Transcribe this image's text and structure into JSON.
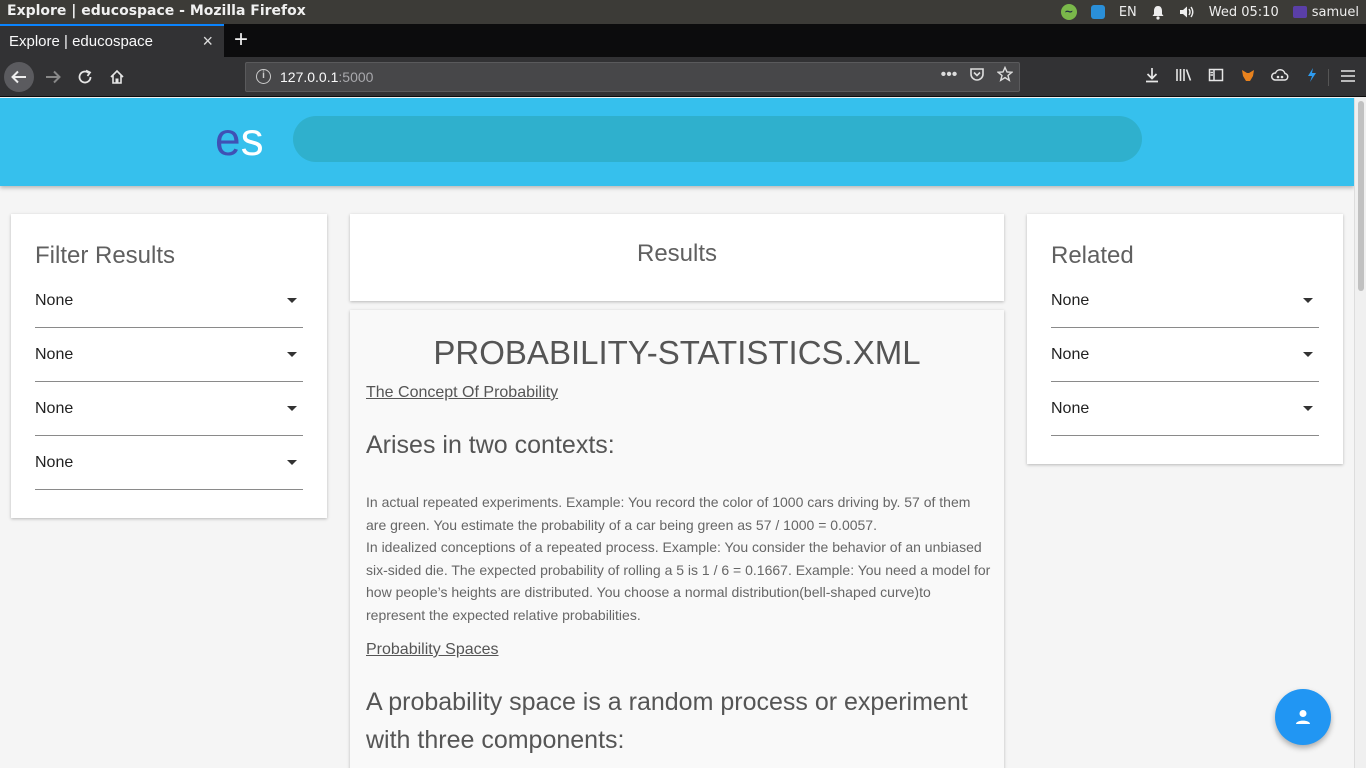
{
  "os": {
    "window_title": "Explore | educospace - Mozilla Firefox",
    "indicators": [
      "EN"
    ],
    "clock": "Wed 05:10",
    "user": "samuel"
  },
  "browser": {
    "tab_title": "Explore | educospace",
    "tab_close": "×",
    "new_tab": "+",
    "url_host": "127.0.0.1",
    "url_port": ":5000",
    "url_more": "•••"
  },
  "app": {
    "logo_e": "e",
    "logo_s": "s",
    "search_placeholder": ""
  },
  "filter": {
    "title": "Filter Results",
    "dropdowns": [
      "None",
      "None",
      "None",
      "None"
    ]
  },
  "results": {
    "title": "Results"
  },
  "related": {
    "title": "Related",
    "dropdowns": [
      "None",
      "None",
      "None"
    ]
  },
  "document": {
    "title": "PROBABILITY-STATISTICS.XML",
    "link1": "The Concept Of Probability",
    "heading1": "Arises in two contexts:",
    "para1": "In actual repeated experiments. Example: You record the color of 1000 cars driving by. 57 of them are green. You estimate the probability of a car being green as 57 / 1000 = 0.0057.",
    "para2": "In idealized conceptions of a repeated process. Example: You consider the behavior of an unbiased six-sided die. The expected probability of rolling a 5 is 1 / 6 = 0.1667. Example: You need a model for how people’s heights are distributed. You choose a normal distribution(bell-shaped curve)to represent the expected relative probabilities.",
    "link2": "Probability Spaces",
    "heading2": "A probability space is a random process or experiment with three components:"
  },
  "fab": {
    "icon": "person-icon"
  }
}
